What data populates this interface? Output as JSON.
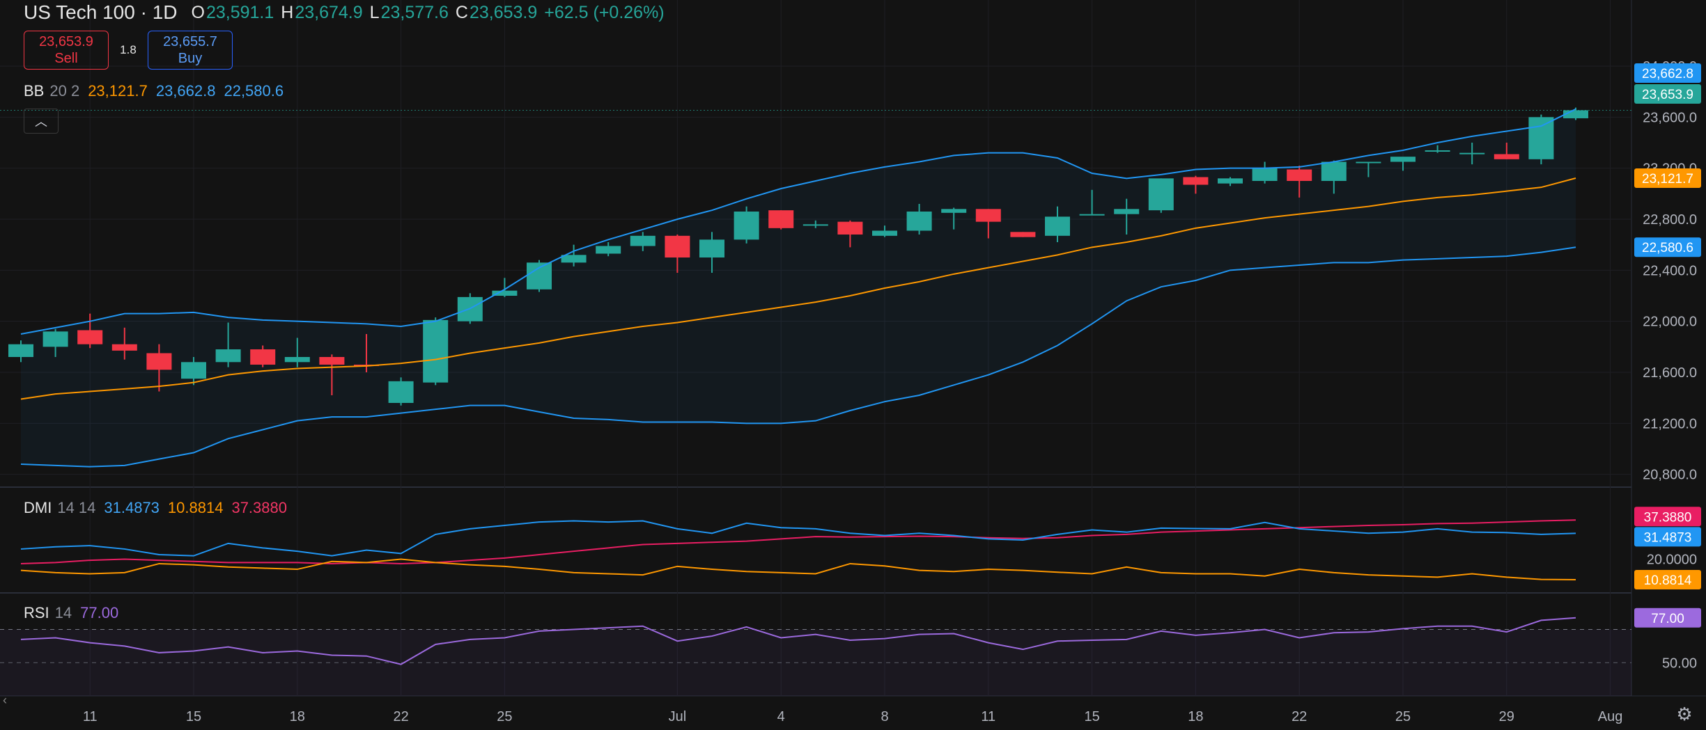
{
  "header": {
    "symbol": "US Tech 100 · 1D",
    "o_label": "O",
    "o": "23,591.1",
    "h_label": "H",
    "h": "23,674.9",
    "l_label": "L",
    "l": "23,577.6",
    "c_label": "C",
    "c": "23,653.9",
    "change": "+62.5 (+0.26%)"
  },
  "trade": {
    "sell_price": "23,653.9",
    "sell_label": "Sell",
    "spread": "1.8",
    "buy_price": "23,655.7",
    "buy_label": "Buy"
  },
  "indicators": {
    "bb": {
      "name": "BB",
      "params": "20 2",
      "basis": "23,121.7",
      "upper": "23,662.8",
      "lower": "22,580.6"
    },
    "dmi": {
      "name": "DMI",
      "params": "14 14",
      "plus": "31.4873",
      "minus": "10.8814",
      "adx": "37.3880"
    },
    "rsi": {
      "name": "RSI",
      "params": "14",
      "value": "77.00"
    }
  },
  "colors": {
    "up": "#26a69a",
    "down": "#f23645",
    "bb_band": "#2196f3",
    "bb_basis": "#ff9800",
    "dmi_plus": "#2196f3",
    "dmi_minus": "#ff9800",
    "adx": "#e91e63",
    "rsi": "#9c6ade"
  },
  "icons": {
    "collapse": "chevron-up-icon",
    "settings": "gear-icon",
    "scroll_left": "chevron-left-icon"
  },
  "chart_data": {
    "type": "candlestick",
    "y_ticks": [
      "24,000.0",
      "23,600.0",
      "23,200.0",
      "22,800.0",
      "22,400.0",
      "22,000.0",
      "21,600.0",
      "21,200.0",
      "20,800.0"
    ],
    "y_tick_values": [
      24000,
      23600,
      23200,
      22800,
      22400,
      22000,
      21600,
      21200,
      20800
    ],
    "ylim": [
      20700,
      24300
    ],
    "x_ticks": [
      {
        "label": "11",
        "i": 2
      },
      {
        "label": "15",
        "i": 5
      },
      {
        "label": "18",
        "i": 8
      },
      {
        "label": "22",
        "i": 11
      },
      {
        "label": "25",
        "i": 14
      },
      {
        "label": "Jul",
        "i": 19
      },
      {
        "label": "4",
        "i": 22
      },
      {
        "label": "8",
        "i": 25
      },
      {
        "label": "11",
        "i": 28
      },
      {
        "label": "15",
        "i": 31
      },
      {
        "label": "18",
        "i": 34
      },
      {
        "label": "22",
        "i": 37
      },
      {
        "label": "25",
        "i": 40
      },
      {
        "label": "29",
        "i": 43
      },
      {
        "label": "Aug",
        "i": 46
      }
    ],
    "ohlc": [
      [
        21720,
        21850,
        21680,
        21820
      ],
      [
        21800,
        21940,
        21720,
        21920
      ],
      [
        21930,
        22060,
        21790,
        21820
      ],
      [
        21820,
        21950,
        21700,
        21770
      ],
      [
        21750,
        21820,
        21450,
        21620
      ],
      [
        21550,
        21720,
        21500,
        21680
      ],
      [
        21680,
        21990,
        21640,
        21780
      ],
      [
        21780,
        21810,
        21640,
        21660
      ],
      [
        21680,
        21870,
        21640,
        21720
      ],
      [
        21720,
        21740,
        21420,
        21660
      ],
      [
        21660,
        21900,
        21600,
        21650
      ],
      [
        21360,
        21560,
        21340,
        21530
      ],
      [
        21520,
        22030,
        21500,
        22010
      ],
      [
        22000,
        22220,
        21980,
        22190
      ],
      [
        22200,
        22340,
        22190,
        22240
      ],
      [
        22250,
        22480,
        22230,
        22460
      ],
      [
        22460,
        22600,
        22430,
        22520
      ],
      [
        22530,
        22620,
        22510,
        22590
      ],
      [
        22590,
        22700,
        22550,
        22670
      ],
      [
        22670,
        22680,
        22380,
        22500
      ],
      [
        22500,
        22700,
        22380,
        22640
      ],
      [
        22640,
        22900,
        22610,
        22860
      ],
      [
        22870,
        22870,
        22720,
        22730
      ],
      [
        22750,
        22790,
        22730,
        22760
      ],
      [
        22780,
        22790,
        22580,
        22680
      ],
      [
        22670,
        22750,
        22660,
        22710
      ],
      [
        22710,
        22920,
        22680,
        22860
      ],
      [
        22850,
        22890,
        22720,
        22880
      ],
      [
        22880,
        22880,
        22650,
        22780
      ],
      [
        22700,
        22700,
        22660,
        22660
      ],
      [
        22670,
        22900,
        22620,
        22820
      ],
      [
        22830,
        23030,
        22830,
        22840
      ],
      [
        22840,
        22960,
        22680,
        22880
      ],
      [
        22870,
        23120,
        22850,
        23120
      ],
      [
        23130,
        23140,
        23000,
        23070
      ],
      [
        23080,
        23130,
        23060,
        23120
      ],
      [
        23100,
        23250,
        23080,
        23200
      ],
      [
        23190,
        23220,
        22970,
        23100
      ],
      [
        23100,
        23260,
        23000,
        23250
      ],
      [
        23240,
        23250,
        23130,
        23250
      ],
      [
        23250,
        23270,
        23180,
        23290
      ],
      [
        23330,
        23380,
        23320,
        23340
      ],
      [
        23320,
        23400,
        23230,
        23320
      ],
      [
        23310,
        23400,
        23270,
        23270
      ],
      [
        23270,
        23620,
        23230,
        23600
      ],
      [
        23591.1,
        23674.9,
        23577.6,
        23653.9
      ]
    ],
    "bb_upper": [
      21900,
      21950,
      22000,
      22060,
      22060,
      22070,
      22030,
      22010,
      22000,
      21990,
      21980,
      21960,
      22000,
      22100,
      22250,
      22420,
      22550,
      22640,
      22720,
      22800,
      22870,
      22960,
      23040,
      23100,
      23160,
      23210,
      23250,
      23300,
      23320,
      23320,
      23280,
      23160,
      23120,
      23150,
      23190,
      23200,
      23200,
      23210,
      23250,
      23300,
      23340,
      23400,
      23450,
      23490,
      23530,
      23662.8
    ],
    "bb_basis": [
      21390,
      21430,
      21450,
      21470,
      21490,
      21520,
      21580,
      21610,
      21630,
      21640,
      21650,
      21670,
      21700,
      21750,
      21790,
      21830,
      21880,
      21920,
      21960,
      21990,
      22030,
      22070,
      22110,
      22150,
      22200,
      22260,
      22310,
      22370,
      22420,
      22470,
      22520,
      22580,
      22620,
      22670,
      22730,
      22770,
      22810,
      22840,
      22870,
      22900,
      22940,
      22970,
      22990,
      23020,
      23050,
      23121.7
    ],
    "bb_lower": [
      20880,
      20870,
      20860,
      20870,
      20920,
      20970,
      21080,
      21150,
      21220,
      21250,
      21250,
      21280,
      21310,
      21340,
      21340,
      21290,
      21240,
      21230,
      21210,
      21210,
      21210,
      21200,
      21200,
      21220,
      21300,
      21370,
      21420,
      21500,
      21580,
      21680,
      21810,
      21980,
      22160,
      22270,
      22320,
      22400,
      22420,
      22440,
      22460,
      22460,
      22480,
      22490,
      22500,
      22510,
      22540,
      22580.6
    ],
    "dmi_ticks": [
      "20.0000"
    ],
    "dmi_ylim": [
      5,
      52
    ],
    "dmi_plus": [
      24.5,
      25.5,
      26,
      24.5,
      22,
      21.5,
      27,
      25,
      23.5,
      21.5,
      24,
      22.5,
      31,
      33.5,
      35,
      36.5,
      37,
      36.5,
      37,
      33.5,
      31.5,
      36,
      34,
      33.5,
      31.5,
      30.5,
      31.5,
      30.5,
      29,
      28.5,
      31,
      33,
      32,
      33.8,
      33.6,
      33.5,
      36.3,
      33.5,
      32.5,
      31.5,
      32,
      33.5,
      32,
      31.8,
      31,
      31.4873
    ],
    "dmi_minus": [
      15,
      14,
      13.5,
      14,
      18,
      17.5,
      16.5,
      16,
      15.5,
      19,
      18.5,
      20,
      18.5,
      17.5,
      16.8,
      15.5,
      14,
      13.5,
      13,
      16.8,
      15.5,
      14.5,
      14,
      13.5,
      18,
      17,
      15,
      14.5,
      15.5,
      15,
      14.2,
      13.5,
      16.5,
      14,
      13.5,
      13.5,
      12.5,
      15.5,
      14,
      13,
      12.5,
      12,
      13.5,
      12,
      11,
      10.8814
    ],
    "dmi_adx": [
      18,
      18.5,
      19.5,
      20,
      19.5,
      19,
      18.5,
      18.5,
      18.5,
      18,
      18.5,
      18,
      18.5,
      19.5,
      20.5,
      22,
      23.5,
      25,
      26.5,
      27,
      27.5,
      28,
      29,
      30,
      29.8,
      30,
      30.2,
      30,
      29.5,
      29.2,
      29.5,
      30.5,
      31,
      32,
      32.5,
      33,
      33.5,
      34,
      34.5,
      35,
      35.3,
      35.8,
      36,
      36.5,
      37,
      37.388
    ],
    "rsi_ticks": [
      "50.00"
    ],
    "rsi_ylim": [
      30,
      92
    ],
    "rsi_bands": [
      30,
      70
    ],
    "rsi": [
      64,
      65,
      62,
      60,
      56,
      57,
      59.5,
      56,
      57,
      54.5,
      54,
      49,
      61,
      64,
      65,
      69,
      70,
      71,
      72,
      63,
      66,
      71.5,
      65,
      67,
      63.5,
      64.5,
      67,
      67.5,
      62,
      58,
      63,
      63.5,
      64,
      69,
      66.5,
      68,
      70,
      65,
      68,
      68.5,
      70.5,
      72,
      72,
      68.5,
      75.5,
      77
    ]
  },
  "price_tags": {
    "bb_upper": "23,662.8",
    "close": "23,653.9",
    "bb_basis": "23,121.7",
    "bb_lower": "22,580.6",
    "adx": "37.3880",
    "dmi_plus": "31.4873",
    "dmi_minus": "10.8814",
    "rsi": "77.00"
  }
}
